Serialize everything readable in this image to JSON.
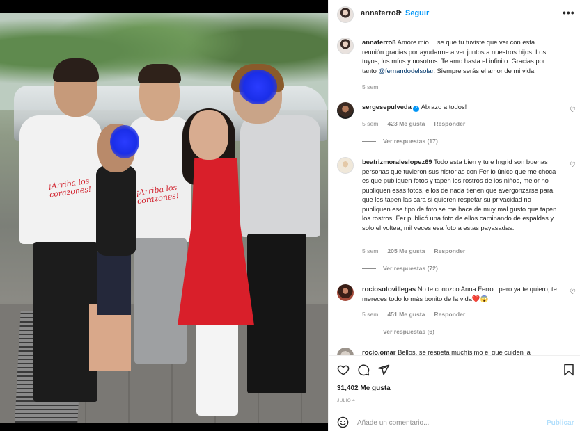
{
  "header": {
    "username": "annaferro8",
    "separator": "•",
    "follow_label": "Seguir",
    "more_label": "•••"
  },
  "caption": {
    "username": "annaferro8",
    "text_before_mention": "Amore mio… se que tu tuviste que ver con esta reunión gracias por ayudarme a ver juntos a nuestros hijos. Los tuyos, los míos y nosotros. Te amo hasta el infinito. Gracias por tanto",
    "mention": "@fernandodelsolar",
    "text_after_mention": ". Siempre serás el amor de mi vida.",
    "time": "5 sem"
  },
  "comments": [
    {
      "username": "sergesepulveda",
      "verified": true,
      "text": "Abrazo a todos!",
      "time": "5 sem",
      "likes": "423 Me gusta",
      "reply_label": "Responder",
      "view_replies": "Ver respuestas (17)"
    },
    {
      "username": "beatrizmoraleslopez69",
      "text": "Todo esta bien y tu e Ingrid son buenas personas que tuvieron sus historias con Fer lo único que me choca es que publiquen fotos y tapen los rostros de los niños, mejor no publiquen esas fotos, ellos de nada tienen que avergonzarse para que les tapen las cara si quieren respetar su privacidad no publiquen ese tipo de foto se me hace de muy mal gusto que tapen los rostros. Fer publicó una foto de ellos caminando de espaldas y solo el voltea, mil veces esa foto a estas payasadas.",
      "time": "5 sem",
      "likes": "205 Me gusta",
      "reply_label": "Responder",
      "view_replies": "Ver respuestas (72)"
    },
    {
      "username": "rociosotovillegas",
      "text": "No te conozco Anna Ferro , pero ya te quiero, te mereces todo lo más bonito de la vida❤️😱",
      "time": "5 sem",
      "likes": "451 Me gusta",
      "reply_label": "Responder",
      "view_replies": "Ver respuestas (6)"
    },
    {
      "username": "rocio.omar",
      "text": "Bellos, se respeta muchísimo el que cuiden la"
    }
  ],
  "photo": {
    "shirt_text": "¡Arriba los corazones!"
  },
  "actions": {
    "like_icon": "heart-icon",
    "comment_icon": "comment-icon",
    "share_icon": "paper-plane-icon",
    "save_icon": "bookmark-icon",
    "likes_count": "31,402 Me gusta",
    "date": "JULIO 4"
  },
  "add_comment": {
    "emoji_icon": "smiley-icon",
    "placeholder": "Añade un comentario...",
    "publish_label": "Publicar"
  },
  "colors": {
    "accent": "#0095f6",
    "mention": "#00376b",
    "muted": "#8e8e8e",
    "publish_disabled": "#b2dffc",
    "like_heart": "#ed4956"
  }
}
